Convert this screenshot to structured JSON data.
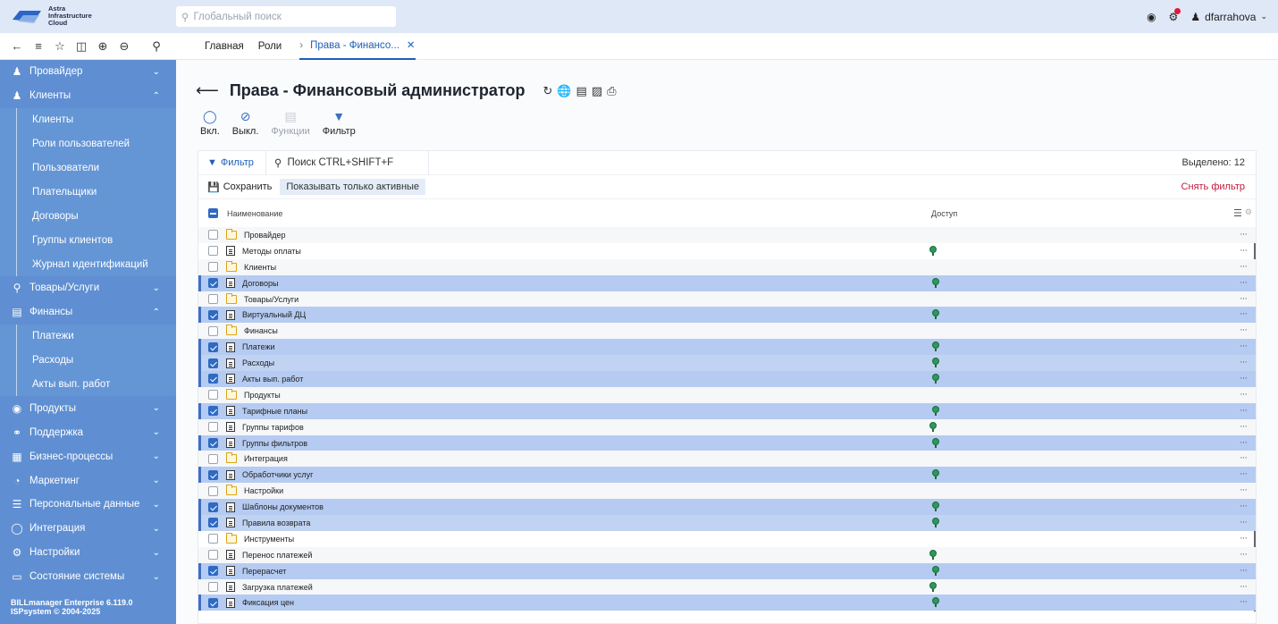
{
  "brand": {
    "line1": "Astra",
    "line2": "Infrastructure",
    "line3": "Cloud"
  },
  "search": {
    "placeholder": "Глобальный поиск"
  },
  "user": {
    "name": "dfarrahova"
  },
  "tabs": [
    {
      "label": "Главная"
    },
    {
      "label": "Роли"
    },
    {
      "label": "Права - Финансо..."
    }
  ],
  "sidebar": {
    "items": [
      {
        "label": "Провайдер",
        "icon": "user-icon",
        "expanded": false
      },
      {
        "label": "Клиенты",
        "icon": "user-icon",
        "expanded": true,
        "children": [
          "Клиенты",
          "Роли пользователей",
          "Пользователи",
          "Плательщики",
          "Договоры",
          "Группы клиентов",
          "Журнал идентификаций"
        ]
      },
      {
        "label": "Товары/Услуги",
        "icon": "basket-icon",
        "expanded": false
      },
      {
        "label": "Финансы",
        "icon": "wallet-icon",
        "expanded": true,
        "children": [
          "Платежи",
          "Расходы",
          "Акты вып. работ"
        ]
      },
      {
        "label": "Продукты",
        "icon": "coin-icon",
        "expanded": false
      },
      {
        "label": "Поддержка",
        "icon": "headset-icon",
        "expanded": false
      },
      {
        "label": "Бизнес-процессы",
        "icon": "process-icon",
        "expanded": false
      },
      {
        "label": "Маркетинг",
        "icon": "pie-icon",
        "expanded": false
      },
      {
        "label": "Персональные данные",
        "icon": "data-icon",
        "expanded": false
      },
      {
        "label": "Интеграция",
        "icon": "toggle-icon",
        "expanded": false
      },
      {
        "label": "Настройки",
        "icon": "settings-icon",
        "expanded": false
      },
      {
        "label": "Состояние системы",
        "icon": "monitor-icon",
        "expanded": false
      }
    ],
    "footer_line1": "BILLmanager Enterprise 6.119.0",
    "footer_line2": "ISPsystem © 2004-2025"
  },
  "page": {
    "title": "Права - Финансовый администратор"
  },
  "actions": [
    {
      "label": "Вкл.",
      "icon": "bulb-on-icon",
      "disabled": false
    },
    {
      "label": "Выкл.",
      "icon": "bulb-off-icon",
      "disabled": false
    },
    {
      "label": "Функции",
      "icon": "functions-icon",
      "disabled": true
    },
    {
      "label": "Фильтр",
      "icon": "filter-icon",
      "disabled": false
    }
  ],
  "filter": {
    "button_label": "Фильтр",
    "search_label": "Поиск CTRL+SHIFT+F",
    "selected_label": "Выделено: 12",
    "save_label": "Сохранить",
    "chip_label": "Показывать только активные",
    "clear_label": "Снять фильтр"
  },
  "table": {
    "col_name": "Наименование",
    "col_access": "Доступ",
    "rows": [
      {
        "name": "Провайдер",
        "type": "folder",
        "selected": false,
        "access": false
      },
      {
        "name": "Методы оплаты",
        "type": "doc",
        "selected": false,
        "access": true
      },
      {
        "name": "Клиенты",
        "type": "folder",
        "selected": false,
        "access": false
      },
      {
        "name": "Договоры",
        "type": "doc",
        "selected": true,
        "access": true
      },
      {
        "name": "Товары/Услуги",
        "type": "folder",
        "selected": false,
        "access": false
      },
      {
        "name": "Виртуальный ДЦ",
        "type": "doc",
        "selected": true,
        "access": true
      },
      {
        "name": "Финансы",
        "type": "folder",
        "selected": false,
        "access": false
      },
      {
        "name": "Платежи",
        "type": "doc",
        "selected": true,
        "access": true
      },
      {
        "name": "Расходы",
        "type": "doc",
        "selected": true,
        "access": true
      },
      {
        "name": "Акты вып. работ",
        "type": "doc",
        "selected": true,
        "access": true
      },
      {
        "name": "Продукты",
        "type": "folder",
        "selected": false,
        "access": false
      },
      {
        "name": "Тарифные планы",
        "type": "doc",
        "selected": true,
        "access": true
      },
      {
        "name": "Группы тарифов",
        "type": "doc",
        "selected": false,
        "access": true
      },
      {
        "name": "Группы фильтров",
        "type": "doc",
        "selected": true,
        "access": true
      },
      {
        "name": "Интеграция",
        "type": "folder",
        "selected": false,
        "access": false
      },
      {
        "name": "Обработчики услуг",
        "type": "doc",
        "selected": true,
        "access": true
      },
      {
        "name": "Настройки",
        "type": "folder",
        "selected": false,
        "access": false
      },
      {
        "name": "Шаблоны документов",
        "type": "doc",
        "selected": true,
        "access": true
      },
      {
        "name": "Правила возврата",
        "type": "doc",
        "selected": true,
        "access": true
      },
      {
        "name": "Инструменты",
        "type": "folder",
        "selected": false,
        "access": false
      },
      {
        "name": "Перенос платежей",
        "type": "doc",
        "selected": false,
        "access": true
      },
      {
        "name": "Перерасчет",
        "type": "doc",
        "selected": true,
        "access": true
      },
      {
        "name": "Загрузка платежей",
        "type": "doc",
        "selected": false,
        "access": true
      },
      {
        "name": "Фиксация цен",
        "type": "doc",
        "selected": true,
        "access": true
      }
    ]
  }
}
